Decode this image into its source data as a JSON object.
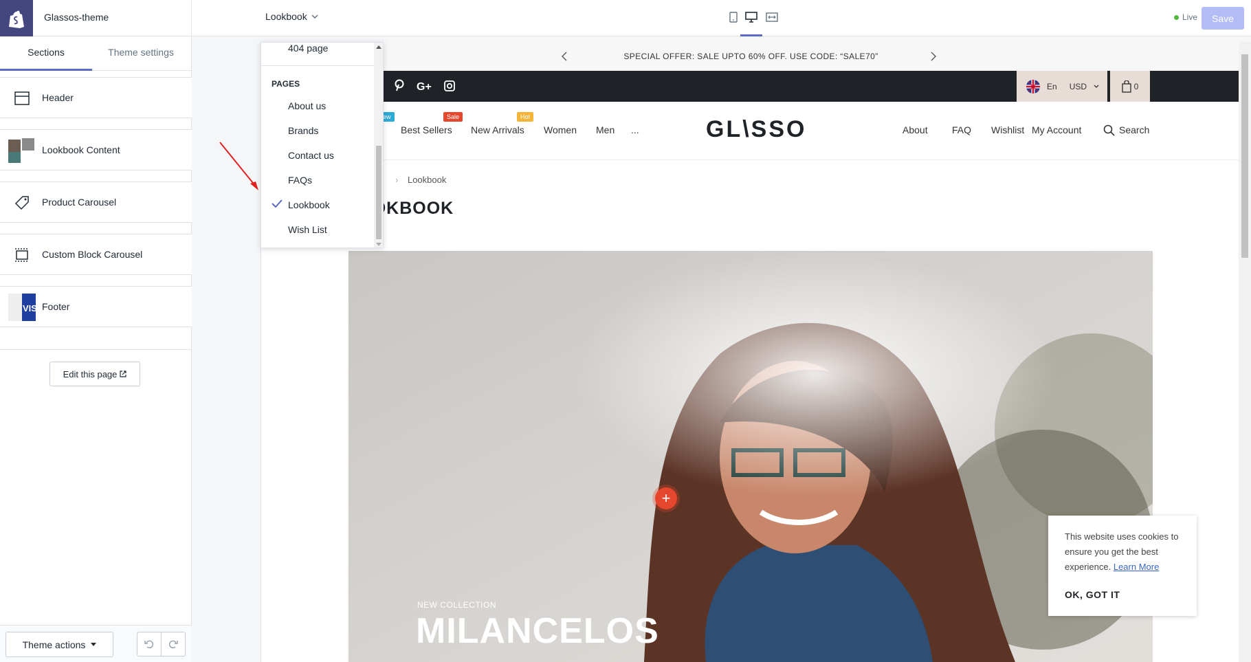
{
  "topbar": {
    "theme_name": "Glassos-theme",
    "page_select": "Lookbook",
    "live_label": "Live",
    "save_label": "Save"
  },
  "sidebar": {
    "tabs": [
      {
        "label": "Sections"
      },
      {
        "label": "Theme settings"
      }
    ],
    "sections": [
      {
        "label": "Header",
        "icon": "header-layout-icon"
      },
      {
        "label": "Lookbook Content",
        "icon": "image-thumbnail-icon"
      },
      {
        "label": "Product Carousel",
        "icon": "tag-icon"
      },
      {
        "label": "Custom Block Carousel",
        "icon": "carousel-icon"
      },
      {
        "label": "Footer",
        "icon": "payment-thumbnail-icon"
      }
    ],
    "edit_page": "Edit this page",
    "theme_actions": "Theme actions"
  },
  "dropdown": {
    "first_item": "404 page",
    "group_header": "PAGES",
    "items": [
      "About us",
      "Brands",
      "Contact us",
      "FAQs",
      "Lookbook",
      "Wish List"
    ],
    "selected": "Lookbook"
  },
  "store": {
    "announcement": "SPECIAL OFFER: SALE UPTO 60% OFF. USE CODE: “SALE70”",
    "language": "En",
    "currency": "USD",
    "cart_count": "0",
    "nav_left": [
      {
        "label": "Best Sellers",
        "badge": "Sale",
        "badge_color": "#e5462e"
      },
      {
        "label": "New Arrivals",
        "badge": "Hot",
        "badge_color": "#f4b43a"
      },
      {
        "label": "Women"
      },
      {
        "label": "Men"
      },
      {
        "label": "..."
      }
    ],
    "partial_badge": "ew",
    "brand": "GL\\SSO",
    "nav_right": [
      "About",
      "FAQ",
      "Wishlist",
      "My Account",
      "Search"
    ],
    "breadcrumb": "Lookbook",
    "page_title": "LOOKBOOK",
    "hero_subtitle": "NEW COLLECTION",
    "hero_title": "MILANCELOS",
    "cookie_text": "This website uses cookies to ensure you get the best experience.",
    "cookie_link": "Learn More",
    "cookie_ok": "OK, GOT IT"
  },
  "colors": {
    "accent": "#5c6ac4",
    "logo_bg": "#43467f",
    "save_bg": "#b3bcf5",
    "live_dot": "#50b83c",
    "dark_bar": "#1f2328",
    "hotspot": "#e5462e",
    "annotation_arrow": "#e02020"
  }
}
